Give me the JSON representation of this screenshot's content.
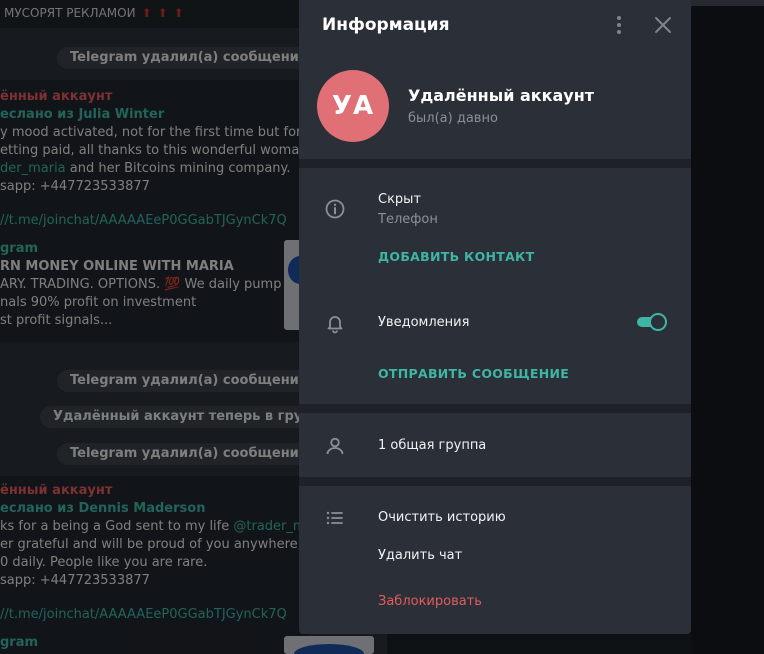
{
  "chat": {
    "top_strip": "МУСОРЯТ РЕКЛАМОИ",
    "top_strip_arrows": "⬆⬆⬆",
    "service_1": "Telegram удалил(а) сообщение:",
    "msg1": {
      "sender": "ённый аккаунт",
      "forwarded": "ес​лано из Julia Winter",
      "lines": [
        "y mood activated, not for the  first time but for th",
        "etting paid, all thanks to this wonderful woman",
        "der_maria and her Bitcoins mining company.",
        "sapp: +447723533877"
      ],
      "link": "//t.me/joinchat/AAAAAEeP0GGabTJGynCk7Q"
    },
    "msg2": {
      "channel": "gram",
      "lines": [
        "RN MONEY ONLINE WITH MARIA",
        "ARY. TRADING. OPTIONS. 💯 We daily pump",
        "nals 90% profit on investment",
        "st profit signals..."
      ]
    },
    "service_2": "Telegram удалил(а) сообщение:",
    "service_3": "Удалённый аккаунт теперь в группе",
    "service_4": "Telegram удалил(а) сообщение:",
    "msg3": {
      "sender": "ённый аккаунт",
      "forwarded": "еслано из Dennis Maderson",
      "line1_a": "ks for a being a God sent to my life ",
      "line1_b": "@trader_ma",
      "lines": [
        "er grateful and will be proud of you anywhere, I n",
        "0 daily. People like you are rare.",
        "sapp: +447723533877"
      ],
      "link": "//t.me/joinchat/AAAAAEeP0GGabTJGynCk7Q",
      "channel": "gram"
    }
  },
  "panel": {
    "title": "Информация",
    "avatar_initials": "УА",
    "avatar_color": "#e17076",
    "name": "Удалённый аккаунт",
    "status": "был(а) давно",
    "phone_value": "Скрыт",
    "phone_label": "Телефон",
    "add_contact": "ДОБАВИТЬ КОНТАКТ",
    "notifications": "Уведомления",
    "notifications_on": true,
    "send_message": "ОТПРАВИТЬ СООБЩЕНИЕ",
    "groups": "1 общая группа",
    "clear_history": "Очистить историю",
    "delete_chat": "Удалить чат",
    "block": "Заблокировать",
    "accent_color": "#3fb5a5",
    "danger_color": "#e35b5b"
  }
}
